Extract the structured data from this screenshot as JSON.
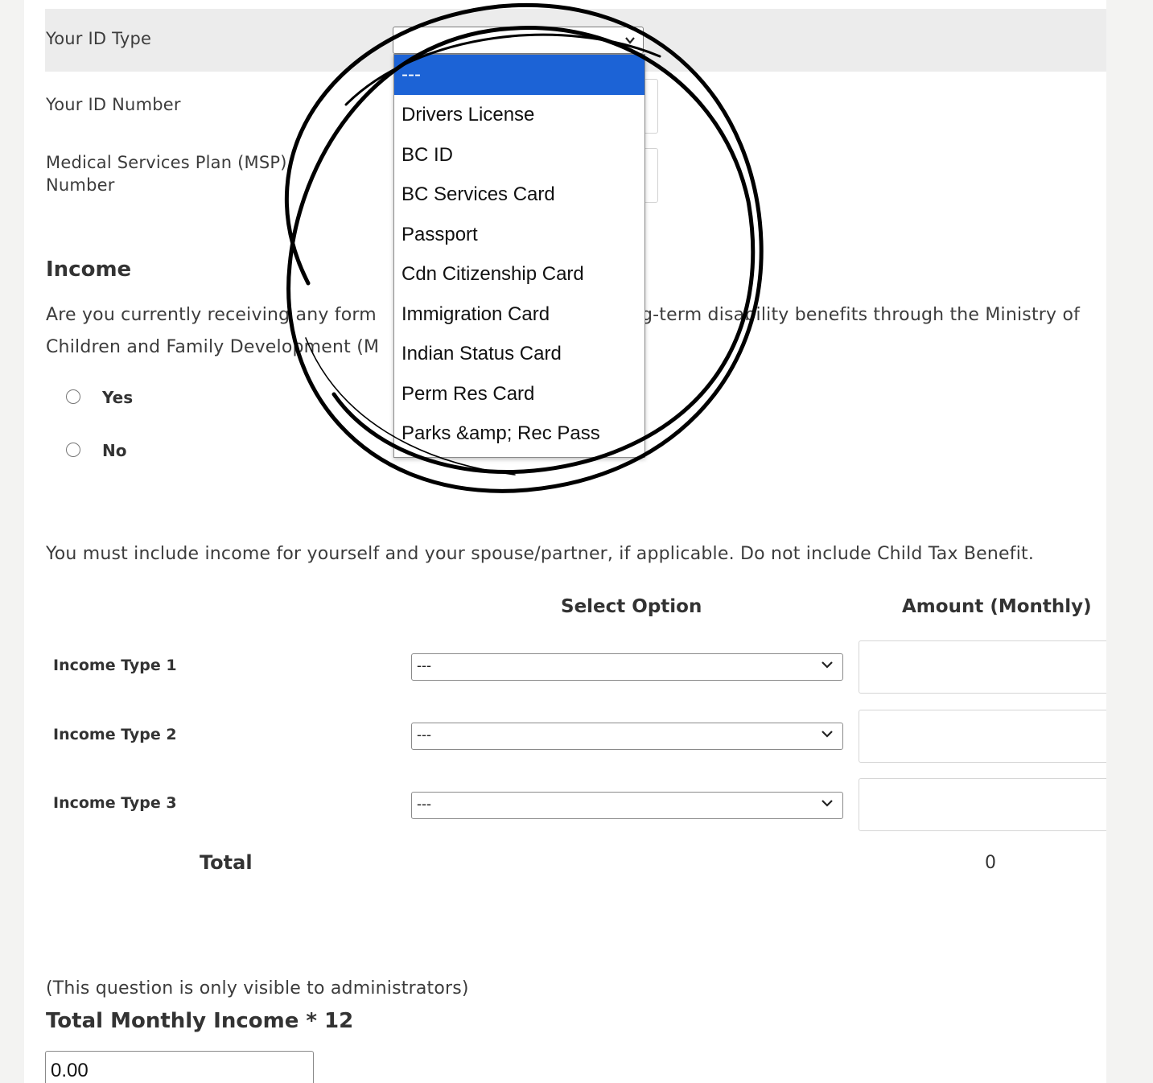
{
  "id_section": {
    "id_type_label": "Your ID Type",
    "id_number_label": "Your ID Number",
    "msp_label_line1": "Medical Services Plan (MSP)",
    "msp_label_line2": "Number"
  },
  "id_type_dropdown": {
    "options": [
      "---",
      "Drivers License",
      "BC ID",
      "BC Services Card",
      "Passport",
      "Cdn Citizenship Card",
      "Immigration Card",
      "Indian Status Card",
      "Perm Res Card",
      "Parks &amp; Rec Pass"
    ],
    "selected_index": 0
  },
  "income": {
    "heading": "Income",
    "question_line1": "Are you currently receiving any form",
    "question_line1_right": "g-term disability benefits through the Ministry of",
    "question_line2": "Children and Family Development (M",
    "options": [
      "Yes",
      "No"
    ]
  },
  "income_table": {
    "note": "You must include income for yourself and your spouse/partner, if applicable. Do not include Child Tax Benefit.",
    "col_select": "Select Option",
    "col_amount": "Amount (Monthly)",
    "rows": [
      {
        "label": "Income Type 1",
        "value": "---"
      },
      {
        "label": "Income Type 2",
        "value": "---"
      },
      {
        "label": "Income Type 3",
        "value": "---"
      }
    ],
    "total_label": "Total",
    "total_value": "0"
  },
  "admin": {
    "note": "(This question is only visible to administrators)",
    "heading": "Total Monthly Income * 12",
    "value": "0.00"
  },
  "colors": {
    "dropdown_highlight": "#1c63d6",
    "id_row_background": "#ececec",
    "page_background": "#f3f3f2"
  }
}
